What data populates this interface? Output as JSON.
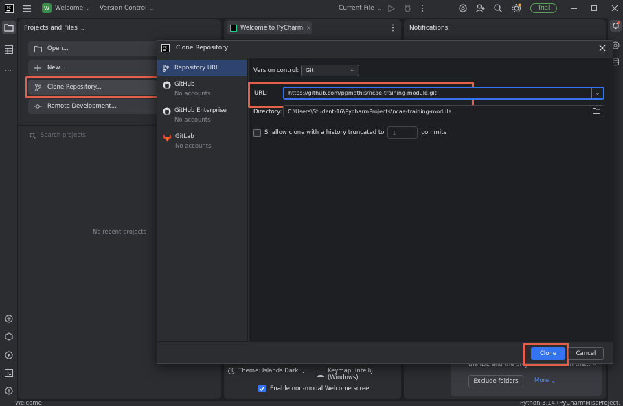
{
  "titlebar": {
    "project_badge": "W",
    "project_name": "Welcome",
    "vcs_menu": "Version Control",
    "run_config": "Current File",
    "trial_label": "Trial"
  },
  "left_panel": {
    "header": "Projects and Files",
    "actions": [
      {
        "label": "Open...",
        "icon": "folder-icon"
      },
      {
        "label": "New...",
        "icon": "plus-icon"
      },
      {
        "label": "Clone Repository...",
        "icon": "vcs-branch-icon"
      },
      {
        "label": "Remote Development...",
        "icon": "remote-icon"
      }
    ],
    "search_placeholder": "Search projects",
    "empty_text": "No recent projects"
  },
  "center_panel": {
    "tab_label": "Welcome to PyCharm",
    "theme_label": "Theme: Islands Dark",
    "keymap_label": "Keymap: IntelliJ (Windows)",
    "modal_checkbox_label": "Enable non-modal Welcome screen",
    "modal_checkbox_checked": true
  },
  "notifications": {
    "header": "Notifications",
    "partial_text": "the IDE and the project folders from the...",
    "exclude_button": "Exclude folders",
    "more_link": "More"
  },
  "dialog": {
    "title": "Clone Repository",
    "sources": [
      {
        "label": "Repository URL",
        "sub": "",
        "icon": "vcs-icon",
        "selected": true
      },
      {
        "label": "GitHub",
        "sub": "No accounts",
        "icon": "github-icon",
        "selected": false
      },
      {
        "label": "GitHub Enterprise",
        "sub": "No accounts",
        "icon": "github-icon",
        "selected": false
      },
      {
        "label": "GitLab",
        "sub": "No accounts",
        "icon": "gitlab-icon",
        "selected": false
      }
    ],
    "vcs_label": "Version control:",
    "vcs_value": "Git",
    "url_label": "URL:",
    "url_value": "https://github.com/ppmathis/ncae-training-module.git",
    "dir_label": "Directory:",
    "dir_value": "C:\\Users\\Student-16\\PycharmProjects\\ncae-training-module",
    "shallow_label": "Shallow clone with a history truncated to",
    "shallow_value": "1",
    "shallow_suffix": "commits",
    "clone_button": "Clone",
    "cancel_button": "Cancel"
  },
  "statusbar": {
    "left": "Welcome",
    "right": "Python 3.14 (PyCharmMiscProject)"
  },
  "colors": {
    "accent": "#3574f0",
    "highlight_box": "#e5604a",
    "selected_row": "#2e436e"
  }
}
